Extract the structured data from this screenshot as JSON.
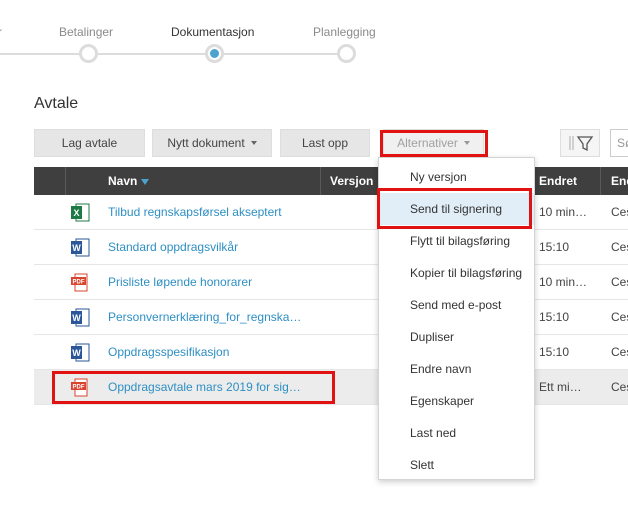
{
  "stepper": {
    "steps": [
      {
        "label": "r"
      },
      {
        "label": "Betalinger"
      },
      {
        "label": "Dokumentasjon"
      },
      {
        "label": "Planlegging"
      }
    ]
  },
  "section": {
    "title": "Avtale"
  },
  "toolbar": {
    "new_agreement": "Lag avtale",
    "new_document": "Nytt dokument",
    "upload": "Last opp",
    "alternatives": "Alternativer",
    "search_placeholder": "Sø"
  },
  "table": {
    "headers": {
      "name": "Navn",
      "version": "Versjon",
      "changed": "Endret",
      "changed_by": "End"
    },
    "rows": [
      {
        "icon": "excel-file-icon",
        "name": "Tilbud regnskapsførsel akseptert",
        "changed": "10 min…",
        "changed_by": "Ces"
      },
      {
        "icon": "word-file-icon",
        "name": "Standard oppdragsvilkår",
        "changed": "15:10",
        "changed_by": "Ces"
      },
      {
        "icon": "pdf-file-icon",
        "name": "Prisliste løpende honorarer",
        "changed": "10 min…",
        "changed_by": "Ces"
      },
      {
        "icon": "word-file-icon",
        "name": "Personvernerklæring_for_regnska…",
        "changed": "15:10",
        "changed_by": "Ces"
      },
      {
        "icon": "word-file-icon",
        "name": "Oppdragsspesifikasjon",
        "changed": "15:10",
        "changed_by": "Ces"
      },
      {
        "icon": "pdf-file-icon",
        "name": "Oppdragsavtale mars 2019 for sig…",
        "changed": "Ett mi…",
        "changed_by": "Ces"
      }
    ]
  },
  "menu": {
    "items": [
      {
        "label": "Ny versjon"
      },
      {
        "label": "Send til signering"
      },
      {
        "label": "Flytt til bilagsføring"
      },
      {
        "label": "Kopier til bilagsføring"
      },
      {
        "label": "Send med e-post"
      },
      {
        "label": "Dupliser"
      },
      {
        "label": "Endre navn"
      },
      {
        "label": "Egenskaper"
      },
      {
        "label": "Last ned"
      },
      {
        "label": "Slett"
      }
    ]
  },
  "colors": {
    "accent": "#4aa3cf",
    "link": "#2e8fc4",
    "header_bg": "#3f3f3f",
    "highlight_border": "#e01212",
    "excel": "#1d7a44",
    "word": "#2b579a",
    "pdf": "#d9442f"
  }
}
